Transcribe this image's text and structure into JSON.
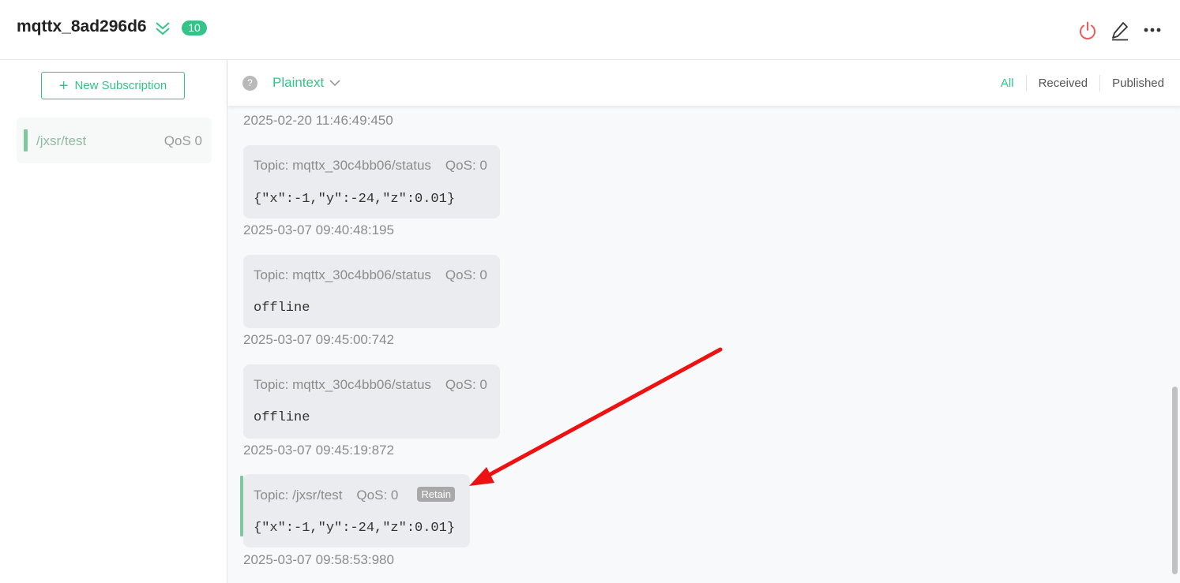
{
  "connection": {
    "name": "mqttx_8ad296d6",
    "message_count": "10"
  },
  "icons": {
    "collapse": "double-chevron-down-icon",
    "disconnect": "power-icon",
    "edit": "pencil-icon",
    "more": "more-dots-icon",
    "help": "help-circle-icon"
  },
  "sidebar": {
    "new_subscription_label": "New Subscription",
    "subscriptions": [
      {
        "topic": "/jxsr/test",
        "qos": "QoS 0",
        "color": "#7fc79e"
      }
    ]
  },
  "toolbar": {
    "help_label": "?",
    "payload_format": "Plaintext",
    "filters": [
      "All",
      "Received",
      "Published"
    ],
    "active_filter": "All"
  },
  "messages": {
    "top_timestamp": "2025-02-20 11:46:49:450",
    "items": [
      {
        "topic": "Topic: mqttx_30c4bb06/status",
        "qos": "QoS: 0",
        "payload": "{\"x\":-1,\"y\":-24,\"z\":0.01}",
        "timestamp": "2025-03-07 09:40:48:195"
      },
      {
        "topic": "Topic: mqttx_30c4bb06/status",
        "qos": "QoS: 0",
        "payload": "offline",
        "timestamp": "2025-03-07 09:45:00:742"
      },
      {
        "topic": "Topic: mqttx_30c4bb06/status",
        "qos": "QoS: 0",
        "payload": "offline",
        "timestamp": "2025-03-07 09:45:19:872"
      },
      {
        "topic": "Topic: /jxsr/test",
        "qos": "QoS: 0",
        "retain": "Retain",
        "payload": "{\"x\":-1,\"y\":-24,\"z\":0.01}",
        "timestamp": "2025-03-07 09:58:53:980"
      }
    ]
  },
  "colors": {
    "accent": "#34c388",
    "disconnect": "#f05a5a",
    "annotation_arrow": "#ee1111"
  }
}
